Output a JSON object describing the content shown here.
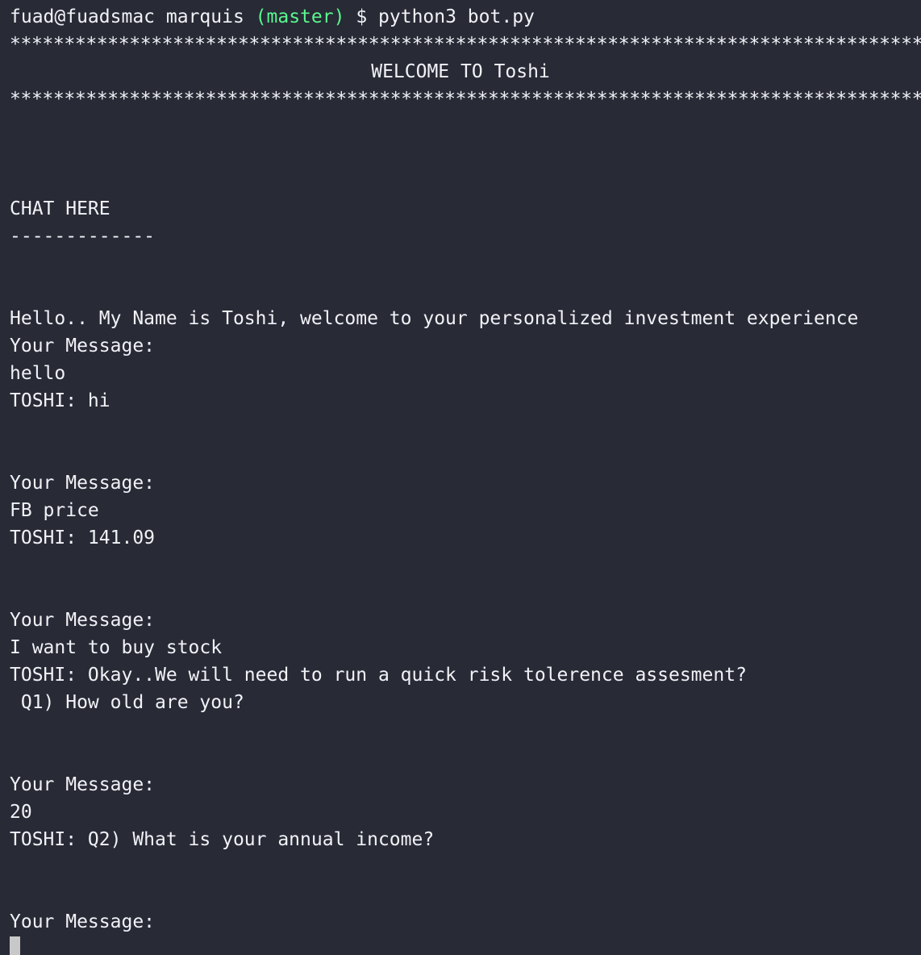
{
  "prompt": {
    "user_host": "fuad@fuadsmac",
    "dir": "marquis",
    "branch": "(master)",
    "symbol": "$",
    "command": "python3 bot.py"
  },
  "banner": {
    "border": "*****************************************************************************************",
    "title": "WELCOME TO Toshi"
  },
  "chat": {
    "header": "CHAT HERE",
    "underline": "-------------"
  },
  "messages": [
    "Hello.. My Name is Toshi, welcome to your personalized investment experience",
    "Your Message:",
    "hello",
    "TOSHI: hi",
    "Your Message:",
    "FB price",
    "TOSHI: 141.09",
    "Your Message:",
    "I want to buy stock",
    "TOSHI: Okay..We will need to run a quick risk tolerence assesment?",
    " Q1) How old are you?",
    "Your Message:",
    "20",
    "TOSHI: Q2) What is your annual income?",
    "Your Message:"
  ],
  "colors": {
    "background": "#282a36",
    "foreground": "#f1f2f6",
    "branch": "#5af78e",
    "cursor": "#c8c8c8"
  }
}
